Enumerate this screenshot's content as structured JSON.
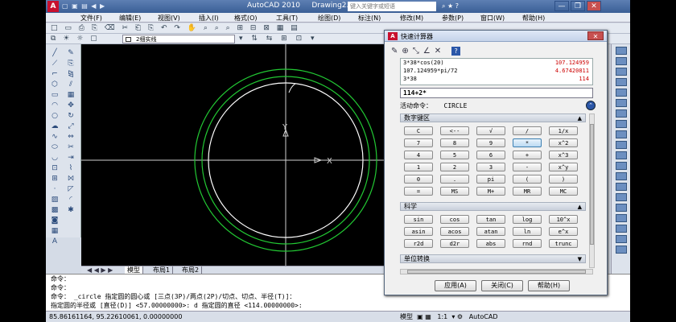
{
  "title_bar": {
    "logo": "A",
    "app_title": "AutoCAD 2010",
    "document": "Drawing2.dwg",
    "search_placeholder": "键入关键字或短语",
    "minimize": "—",
    "restore": "❐",
    "close": "✕"
  },
  "menu": [
    "文件(F)",
    "编辑(E)",
    "视图(V)",
    "插入(I)",
    "格式(O)",
    "工具(T)",
    "绘图(D)",
    "标注(N)",
    "修改(M)",
    "参数(P)",
    "窗口(W)",
    "帮助(H)"
  ],
  "layer": {
    "name": "2细实线",
    "color": "#ffffff"
  },
  "ucs": {
    "y_label": "Y",
    "x_label": "X"
  },
  "layout_tabs": [
    "模型",
    "布局1",
    "布局2"
  ],
  "command_lines": [
    "命令：",
    "命令：",
    "命令： _circle 指定圆的圆心或 [三点(3P)/两点(2P)/切点、切点、半径(T)]：",
    "指定圆的半径或 [直径(D)] <57.00000000>: d 指定圆的直径 <114.00000000>:"
  ],
  "status": {
    "coords": "85.86161164, 95.22610061, 0.00000000",
    "model": "模型",
    "scale": "1:1",
    "workspace": "AutoCAD"
  },
  "quickcalc": {
    "title": "快速计算器",
    "close": "✕",
    "help": "?",
    "history": [
      {
        "expr": "3*38*cos(20)",
        "result": "107.124959"
      },
      {
        "expr": "107.124959*pi/72",
        "result": "4.67420811"
      },
      {
        "expr": "3*38",
        "result": "114"
      }
    ],
    "input": "114+2*",
    "active_label": "活动命令：",
    "active_value": "CIRCLE",
    "numeric_section": "数字键区",
    "numeric_keys": [
      [
        "C",
        "<--",
        "√",
        "/",
        "1/x"
      ],
      [
        "7",
        "8",
        "9",
        "*",
        "x^2"
      ],
      [
        "4",
        "5",
        "6",
        "+",
        "x^3"
      ],
      [
        "1",
        "2",
        "3",
        "-",
        "x^y"
      ],
      [
        "0",
        ".",
        "pi",
        "(",
        ")"
      ],
      [
        "=",
        "MS",
        "M+",
        "MR",
        "MC"
      ]
    ],
    "science_section": "科学",
    "science_keys": [
      [
        "sin",
        "cos",
        "tan",
        "log",
        "10^x"
      ],
      [
        "asin",
        "acos",
        "atan",
        "ln",
        "e^x"
      ],
      [
        "r2d",
        "d2r",
        "abs",
        "rnd",
        "trunc"
      ]
    ],
    "unit_section": "单位转换",
    "buttons": {
      "apply": "应用(A)",
      "close": "关闭(C)",
      "help": "帮助(H)"
    }
  }
}
